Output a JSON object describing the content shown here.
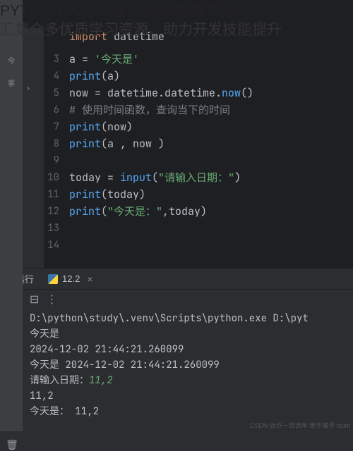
{
  "overlay": {
    "line1": "PYTHON 人马大战 CSDN 免费专区，",
    "line2": "汇集众多优质学习资源，助力开发技能提升"
  },
  "editor": {
    "lines": [
      {
        "num": "",
        "import_kw": "import",
        "import_mod": " datetime"
      },
      {
        "num": "3",
        "assign_var": "a = ",
        "assign_str": "'今天是'"
      },
      {
        "num": "4",
        "print_fn": "print",
        "print_args": "(a)"
      },
      {
        "num": "5",
        "now_var": "now = datetime.datetime.",
        "now_fn": "now",
        "now_end": "()"
      },
      {
        "num": "6",
        "comment": "# 使用时间函数，查询当下的时间"
      },
      {
        "num": "7",
        "print_fn": "print",
        "print_args": "(now)"
      },
      {
        "num": "8",
        "print_fn": "print",
        "print_args": "(a , now )"
      },
      {
        "num": "9"
      },
      {
        "num": "10",
        "today_var": "today = ",
        "input_fn": "input",
        "input_open": "(",
        "input_str": "\"请输入日期：\"",
        "input_close": ")"
      },
      {
        "num": "11",
        "print_fn": "print",
        "print_args": "(today)"
      },
      {
        "num": "12",
        "print_fn": "print",
        "print_open": "(",
        "print_str": "\"今天是：\"",
        "print_rest": ",today)"
      },
      {
        "num": "13"
      },
      {
        "num": "14"
      }
    ]
  },
  "run": {
    "label": "运行",
    "tab_name": "12.2",
    "console": {
      "path": "D:\\python\\study\\.venv\\Scripts\\python.exe D:\\pyt",
      "out1": "今天是",
      "out2": "2024-12-02 21:44:21.260099",
      "out3": "今天是 2024-12-02 21:44:21.260099",
      "prompt": "请输入日期：",
      "input": "11,2",
      "out4": "11,2",
      "out5": "今天是： 11,2"
    }
  },
  "sidebar": {
    "item1": "今",
    "item2": "享"
  },
  "watermark": "CSDN @许一世流年 绝不离手 cium"
}
